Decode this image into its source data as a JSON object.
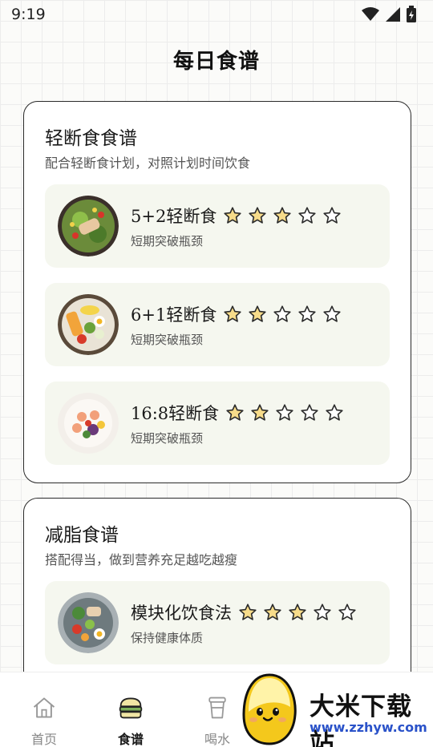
{
  "status": {
    "time": "9:19",
    "icons": [
      "wifi-icon",
      "signal-icon",
      "battery-icon"
    ]
  },
  "page": {
    "title": "每日食谱"
  },
  "sections": [
    {
      "title": "轻断食食谱",
      "subtitle": "配合轻断食计划，对照计划时间饮食",
      "recipes": [
        {
          "name": "5+2轻断食",
          "desc": "短期突破瓶颈",
          "rating": 3,
          "max": 5,
          "image": "chicken-salad-bowl"
        },
        {
          "name": "6+1轻断食",
          "desc": "短期突破瓶颈",
          "rating": 2,
          "max": 5,
          "image": "egg-veggie-bowl"
        },
        {
          "name": "16:8轻断食",
          "desc": "短期突破瓶颈",
          "rating": 2,
          "max": 5,
          "image": "shrimp-salad-bowl"
        }
      ]
    },
    {
      "title": "减脂食谱",
      "subtitle": "搭配得当，做到营养充足越吃越瘦",
      "recipes": [
        {
          "name": "模块化饮食法",
          "desc": "保持健康体质",
          "rating": 3,
          "max": 5,
          "image": "cobb-salad-bowl"
        }
      ]
    }
  ],
  "nav": [
    {
      "label": "首页",
      "icon": "home-icon",
      "active": false
    },
    {
      "label": "食谱",
      "icon": "burger-icon",
      "active": true
    },
    {
      "label": "喝水",
      "icon": "cup-icon",
      "active": false
    }
  ],
  "watermark": {
    "text": "大米下载站",
    "url": "www.zzhyw.com"
  },
  "colors": {
    "star_fill": "#f7dc8a",
    "star_stroke": "#2a2a2a",
    "recipe_bg": "#f5f7ef",
    "card_border": "#2a2a2a"
  }
}
